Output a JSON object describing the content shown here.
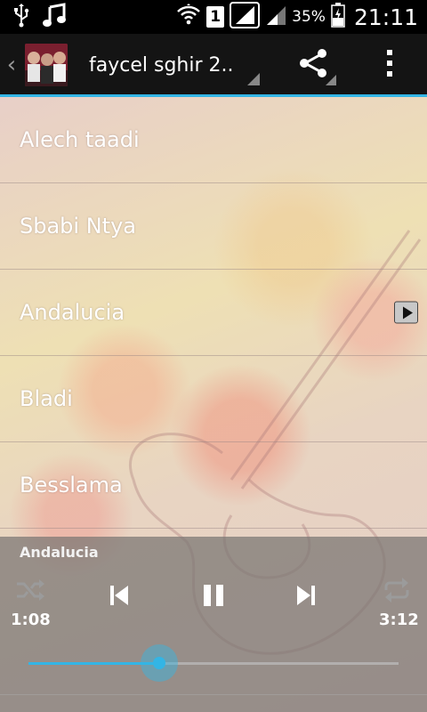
{
  "status_bar": {
    "icons": [
      "usb-icon",
      "music-note-icon",
      "wifi-icon",
      "sim-icon",
      "signal-icon",
      "signal-icon",
      "battery-icon"
    ],
    "sim_number": "1",
    "battery_percent": "35%",
    "time": "21:11"
  },
  "action_bar": {
    "title": "faycel sghir 2..",
    "icons": [
      "back-chevron-icon",
      "app-cover-icon",
      "share-icon",
      "overflow-menu-icon"
    ]
  },
  "tracks": [
    {
      "title": "Alech taadi",
      "playing": false
    },
    {
      "title": "Sbabi Ntya",
      "playing": false
    },
    {
      "title": "Andalucia",
      "playing": true
    },
    {
      "title": "Bladi",
      "playing": false
    },
    {
      "title": "Besslama",
      "playing": false
    }
  ],
  "player": {
    "current_track": "Andalucia",
    "elapsed": "1:08",
    "duration": "3:12",
    "progress_fraction": 0.354,
    "controls": [
      "shuffle-icon",
      "previous-icon",
      "pause-icon",
      "next-icon",
      "repeat-icon"
    ]
  },
  "colors": {
    "accent": "#33b5e5",
    "action_bar_bg": "#141414",
    "status_bar_bg": "#000000"
  }
}
